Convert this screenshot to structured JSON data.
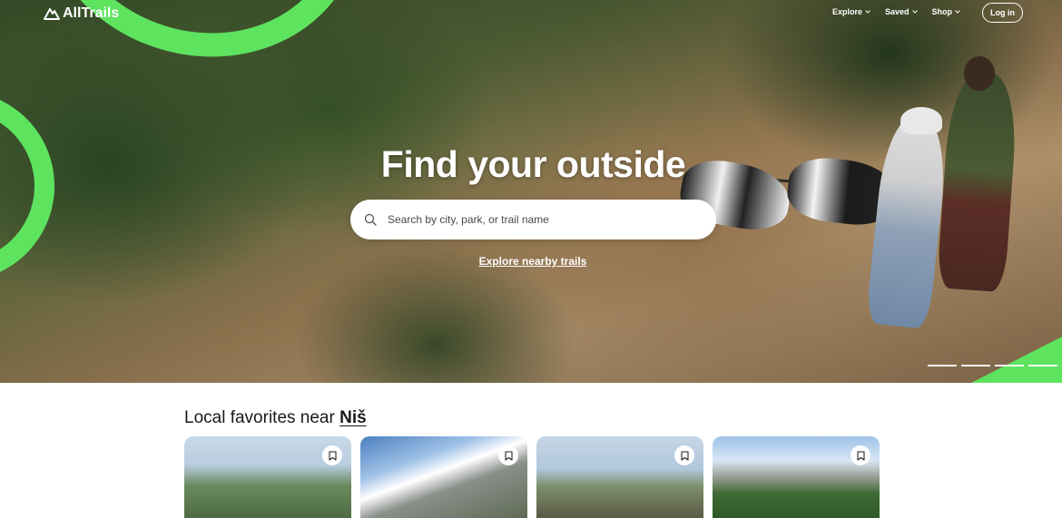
{
  "brand": {
    "name": "AllTrails",
    "logo_icon": "mountain-logo-icon",
    "accent_color": "#5ee35f"
  },
  "nav": {
    "links": [
      {
        "label": "Explore",
        "icon": "chevron-down-icon"
      },
      {
        "label": "Saved",
        "icon": "chevron-down-icon"
      },
      {
        "label": "Shop",
        "icon": "chevron-down-icon"
      }
    ],
    "login_label": "Log in"
  },
  "hero": {
    "title": "Find your outside",
    "search": {
      "placeholder": "Search by city, park, or trail name",
      "value": "",
      "icon": "search-icon"
    },
    "explore_link": "Explore nearby trails",
    "carousel_slides": 4
  },
  "local_favorites": {
    "title_prefix": "Local favorites near ",
    "place": "Niš",
    "cards_icon": "bookmark-icon",
    "cards": [
      {},
      {},
      {},
      {}
    ]
  }
}
